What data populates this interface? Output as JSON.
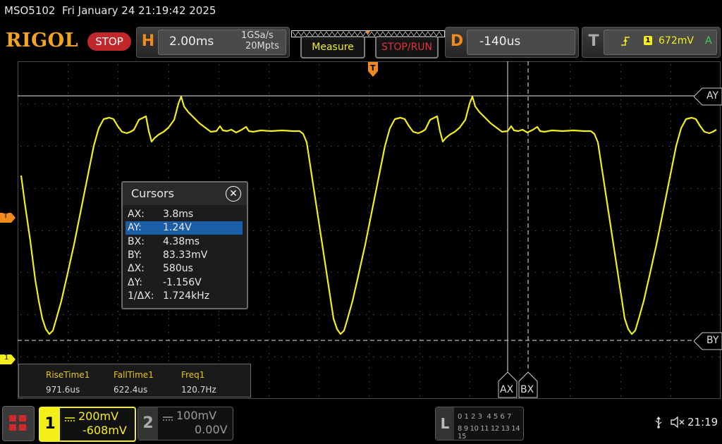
{
  "status_bar": {
    "model": "MSO5102",
    "datetime": "Fri January 24 21:19:42 2025"
  },
  "logo": "RIGOL",
  "run_state": "STOP",
  "horizontal": {
    "letter": "H",
    "scale": "2.00ms",
    "sample_rate": "1GSa/s",
    "memory_depth": "20Mpts"
  },
  "buttons": {
    "measure": "Measure",
    "stop_run": "STOP/RUN"
  },
  "delay": {
    "letter": "D",
    "value": "-140us"
  },
  "trigger": {
    "letter": "T",
    "source": "1",
    "level": "672mV",
    "mode": "A"
  },
  "markers": {
    "trigger_pos": "T",
    "trigger_level": "T",
    "channel1": "1"
  },
  "cursor_labels": {
    "ay": "AY",
    "by": "BY",
    "ax": "AX",
    "bx": "BX"
  },
  "cursors_dialog": {
    "title": "Cursors",
    "close": "✕",
    "rows": [
      {
        "key": "AX:",
        "value": "3.8ms",
        "selected": false
      },
      {
        "key": "AY:",
        "value": "1.24V",
        "selected": true
      },
      {
        "key": "BX:",
        "value": "4.38ms",
        "selected": false
      },
      {
        "key": "BY:",
        "value": "83.33mV",
        "selected": false
      },
      {
        "key": "ΔX:",
        "value": "580us",
        "selected": false
      },
      {
        "key": "ΔY:",
        "value": "-1.156V",
        "selected": false
      },
      {
        "key": "1/ΔX:",
        "value": "1.724kHz",
        "selected": false
      }
    ]
  },
  "measurements": [
    {
      "name": "RiseTime1",
      "value": "971.6us"
    },
    {
      "name": "FallTime1",
      "value": "622.4us"
    },
    {
      "name": "Freq1",
      "value": "120.7Hz"
    }
  ],
  "ch1": {
    "number": "1",
    "scale": "200mV",
    "offset": "-608mV"
  },
  "ch2": {
    "number": "2",
    "scale": "100mV",
    "offset": "0.00V"
  },
  "logic": {
    "letter": "L",
    "row1": "0 1 2 3  4 5 6 7",
    "row2": "8 9 10 11 12 13 14 15"
  },
  "clock": "21:19",
  "colors": {
    "ch1": "#f4ee1a",
    "accent": "#f08a1c",
    "stop": "#c0282c",
    "cursor_sel": "#1b5ea8"
  }
}
